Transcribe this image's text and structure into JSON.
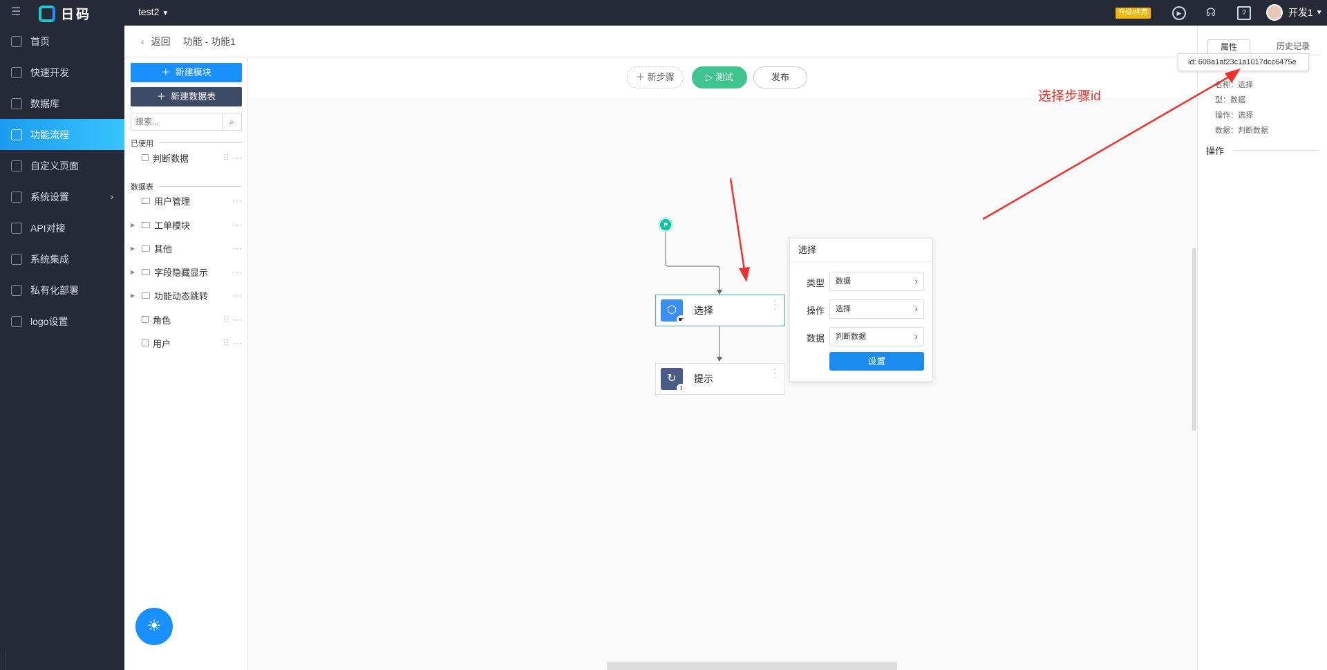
{
  "topbar": {
    "logo_text": "日码",
    "project": "test2",
    "upgrade_badge": "升级/续费",
    "user_name": "开发1"
  },
  "sidebar": {
    "items": [
      {
        "label": "首页"
      },
      {
        "label": "快速开发"
      },
      {
        "label": "数据库"
      },
      {
        "label": "功能流程",
        "active": true
      },
      {
        "label": "自定义页面"
      },
      {
        "label": "系统设置"
      },
      {
        "label": "API对接"
      },
      {
        "label": "系统集成"
      },
      {
        "label": "私有化部署"
      },
      {
        "label": "logo设置"
      }
    ],
    "active_color": "#1b9bf0"
  },
  "breadcrumb": {
    "back": "返回",
    "path": "功能 - 功能1"
  },
  "left_panel": {
    "new_module": "新建模块",
    "new_table": "新建数据表",
    "search_placeholder": "搜索...",
    "used_label": "已使用",
    "used_items": [
      {
        "label": "判断数据"
      }
    ],
    "tables_label": "数据表",
    "tables": [
      {
        "label": "用户管理"
      },
      {
        "label": "工单模块"
      },
      {
        "label": "其他"
      },
      {
        "label": "字段隐藏显示"
      },
      {
        "label": "功能动态跳转"
      },
      {
        "label": "角色"
      },
      {
        "label": "用户"
      }
    ]
  },
  "canvas": {
    "btn_new_step": "新步骤",
    "btn_test": "测试",
    "btn_publish": "发布",
    "nodes": [
      {
        "label": "选择"
      },
      {
        "label": "提示"
      }
    ]
  },
  "popover": {
    "title": "选择",
    "rows": [
      {
        "label": "类型",
        "value": "数据"
      },
      {
        "label": "操作",
        "value": "选择"
      },
      {
        "label": "数据",
        "value": "判断数据"
      }
    ],
    "set_button": "设置"
  },
  "right_panel": {
    "tab_properties": "属性",
    "tab_history": "历史记录",
    "props": [
      {
        "text": "名称：选择"
      },
      {
        "text": "型：数据"
      },
      {
        "text": "操作：选择"
      },
      {
        "text": "数据：判断数据"
      }
    ],
    "section_ops": "操作",
    "tooltip_id": "id: 608a1af23c1a1017dcc6475e"
  },
  "annotation": {
    "text": "选择步骤id",
    "color": "#f0302a"
  }
}
